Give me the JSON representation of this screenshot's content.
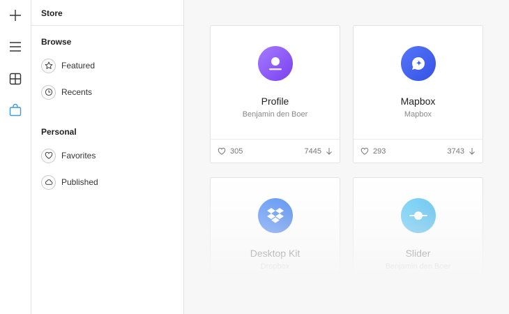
{
  "sidebar": {
    "header": "Store",
    "sections": [
      {
        "title": "Browse",
        "items": [
          {
            "label": "Featured",
            "icon": "star-icon"
          },
          {
            "label": "Recents",
            "icon": "clock-icon"
          }
        ]
      },
      {
        "title": "Personal",
        "items": [
          {
            "label": "Favorites",
            "icon": "heart-icon"
          },
          {
            "label": "Published",
            "icon": "cloud-icon"
          }
        ]
      }
    ]
  },
  "rail": {
    "icons": [
      "plus-icon",
      "menu-icon",
      "grid-icon",
      "bag-icon"
    ],
    "active_color": "#3b9ad9"
  },
  "cards": [
    {
      "title": "Profile",
      "author": "Benjamin den Boer",
      "likes": "305",
      "downloads": "7445",
      "logo_gradient": [
        "#9b6bff",
        "#7a3ff0"
      ],
      "icon": "user-icon"
    },
    {
      "title": "Mapbox",
      "author": "Mapbox",
      "likes": "293",
      "downloads": "3743",
      "logo_gradient": [
        "#4a6ff7",
        "#3754e8"
      ],
      "icon": "map-pin-icon"
    },
    {
      "title": "Desktop Kit",
      "author": "Dropbox",
      "logo_gradient": [
        "#4a8cf7",
        "#2f6fe8"
      ],
      "icon": "dropbox-icon"
    },
    {
      "title": "Slider",
      "author": "Benjamin den Boer",
      "logo_gradient": [
        "#5bc6f5",
        "#3aaee8"
      ],
      "icon": "slider-icon"
    }
  ]
}
